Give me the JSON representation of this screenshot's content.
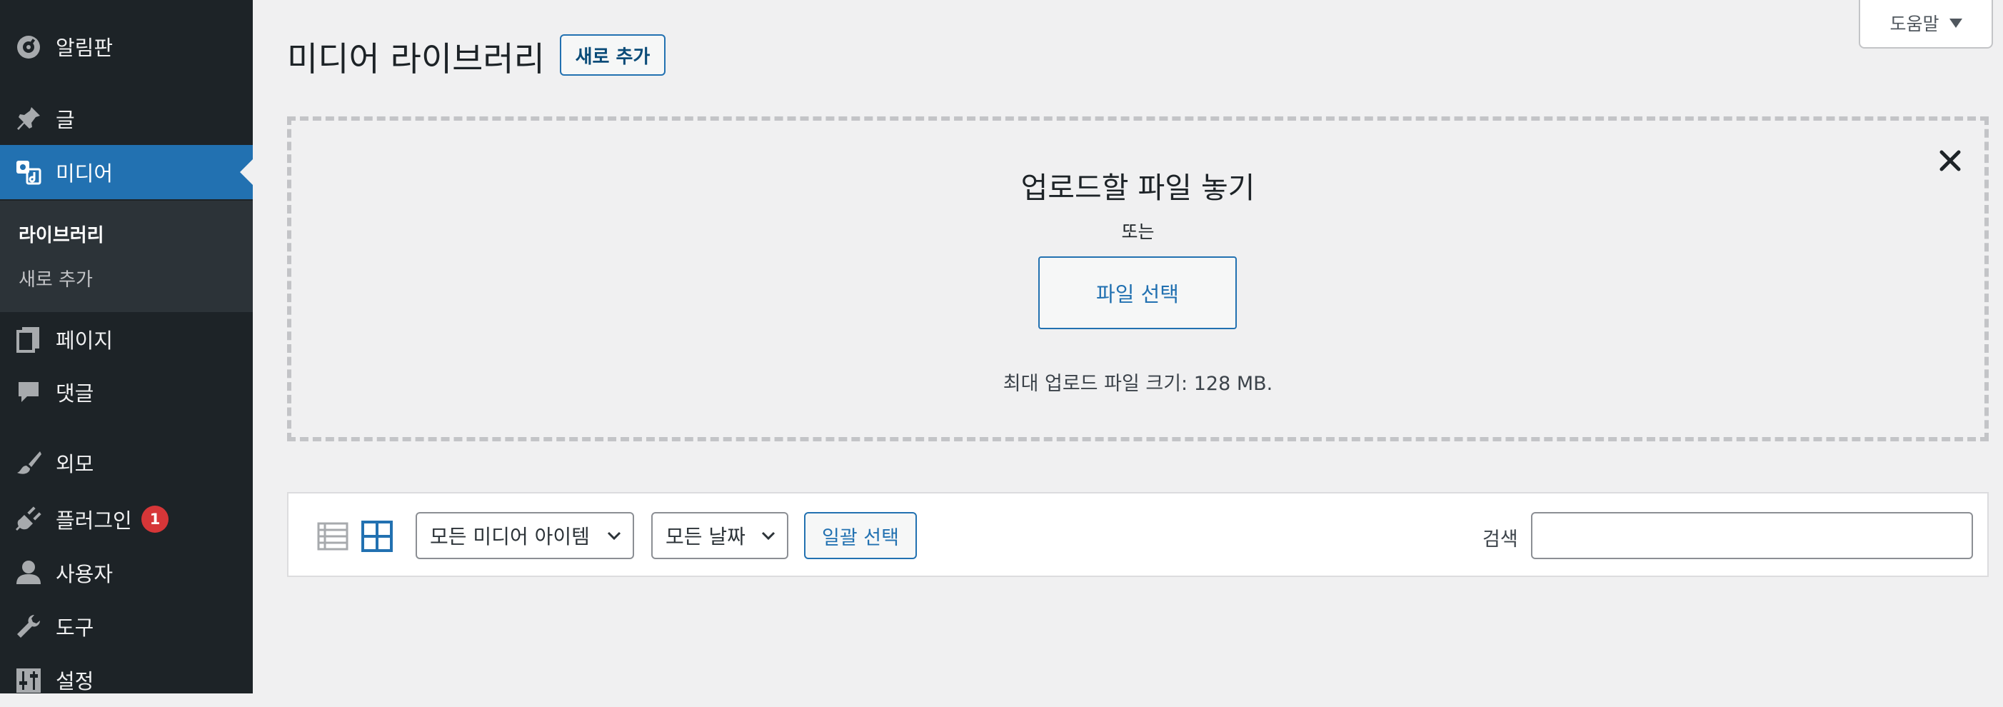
{
  "sidebar": {
    "items": [
      {
        "id": "dashboard",
        "label": "알림판",
        "icon": "dashboard-icon"
      },
      {
        "id": "posts",
        "label": "글",
        "icon": "pushpin-icon"
      },
      {
        "id": "media",
        "label": "미디어",
        "icon": "media-icon",
        "active": true
      },
      {
        "id": "pages",
        "label": "페이지",
        "icon": "pages-icon"
      },
      {
        "id": "comments",
        "label": "댓글",
        "icon": "comment-icon"
      },
      {
        "id": "appearance",
        "label": "외모",
        "icon": "paintbrush-icon"
      },
      {
        "id": "plugins",
        "label": "플러그인",
        "icon": "plugin-icon",
        "badge": "1"
      },
      {
        "id": "users",
        "label": "사용자",
        "icon": "user-icon"
      },
      {
        "id": "tools",
        "label": "도구",
        "icon": "wrench-icon"
      },
      {
        "id": "settings",
        "label": "설정",
        "icon": "settings-sliders-icon"
      }
    ],
    "submenu": [
      {
        "label": "라이브러리",
        "current": true
      },
      {
        "label": "새로 추가",
        "current": false
      }
    ],
    "colors": {
      "background": "#1d2327",
      "active": "#2271b1",
      "submenu": "#2c3338",
      "badge": "#d63638"
    }
  },
  "header": {
    "title": "미디어 라이브러리",
    "add_new_label": "새로 추가",
    "help_label": "도움말"
  },
  "uploader": {
    "title": "업로드할 파일 놓기",
    "or_text": "또는",
    "select_button": "파일 선택",
    "max_size": "최대 업로드 파일 크기: 128 MB."
  },
  "toolbar": {
    "view_modes": [
      {
        "name": "list-view-icon",
        "active": false
      },
      {
        "name": "grid-view-icon",
        "active": true
      }
    ],
    "filter_type": "모든 미디어 아이템",
    "filter_date": "모든 날짜",
    "bulk_select": "일괄 선택",
    "search_label": "검색",
    "search_value": ""
  },
  "accent_color": "#2271b1"
}
